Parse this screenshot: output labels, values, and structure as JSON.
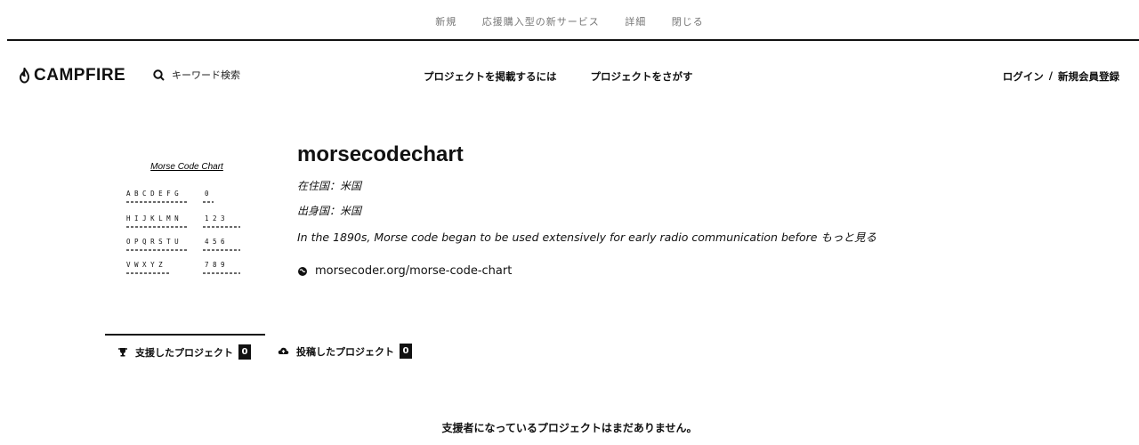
{
  "topbar": {
    "notice_items": [
      "新規",
      "応援購入型の新サービス",
      "詳細",
      "閉じる"
    ]
  },
  "header": {
    "logo_text": "CAMPFIRE",
    "search_placeholder": "キーワード検索",
    "nav": [
      {
        "label": "プロジェクトを掲載するには"
      },
      {
        "label": "プロジェクトをさがす"
      }
    ],
    "auth": {
      "login": "ログイン",
      "separator": "/",
      "signup": "新規会員登録"
    }
  },
  "profile": {
    "name": "morsecodechart",
    "residence": "在住国：米国",
    "birthplace": "出身国：米国",
    "bio": "In the 1890s, Morse code began to be used extensively for early radio communication before",
    "more": "もっと見る",
    "website": "morsecoder.org/morse-code-chart",
    "image_title": "Morse Code Chart",
    "image_rows": [
      {
        "letters": "A B C D E F G",
        "nums": "0"
      },
      {
        "letters": "H I J K L M N",
        "nums": "1 2 3"
      },
      {
        "letters": "O P Q R S T U",
        "nums": "4 5 6"
      },
      {
        "letters": "V W X Y Z",
        "nums": "7 8 9"
      }
    ]
  },
  "tabs": [
    {
      "label": "支援したプロジェクト",
      "count": "0",
      "active": true
    },
    {
      "label": "投稿したプロジェクト",
      "count": "0",
      "active": false
    }
  ],
  "empty_message": "支援者になっているプロジェクトはまだありません。",
  "colors": {
    "text": "#111111",
    "background": "#ffffff",
    "badge": "#111111"
  }
}
